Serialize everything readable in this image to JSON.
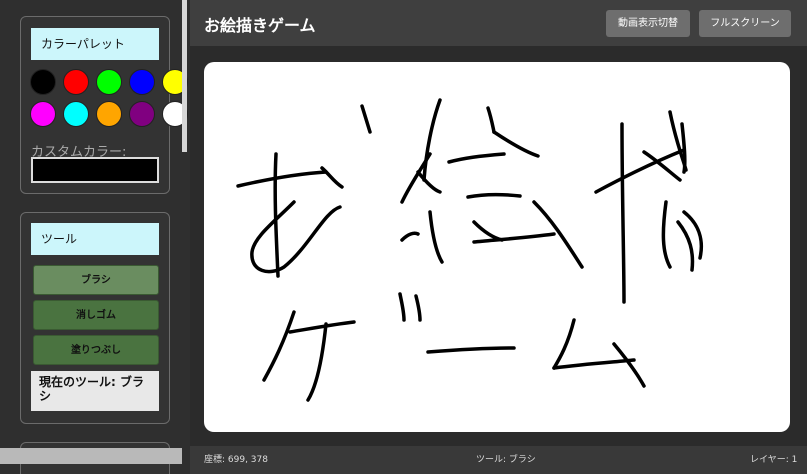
{
  "app": {
    "title": "お絵描きゲーム"
  },
  "header": {
    "video_toggle_label": "動画表示切替",
    "fullscreen_label": "フルスクリーン"
  },
  "color_palette": {
    "title": "カラーパレット",
    "swatches": [
      "#000000",
      "#ff0000",
      "#00ff00",
      "#0000ff",
      "#ffff00",
      "#ff00ff",
      "#00ffff",
      "#ffa500",
      "#800080",
      "#ffffff"
    ],
    "custom_label": "カスタムカラー:",
    "custom_value": "#000000"
  },
  "tools": {
    "title": "ツール",
    "brush_label": "ブラシ",
    "eraser_label": "消しゴム",
    "fill_label": "塗りつぶし",
    "current_tool_text": "現在のツール: ブラシ"
  },
  "statusbar": {
    "coordinates": "座標: 699, 378",
    "tool": "ツール: ブラシ",
    "layer": "レイヤー: 1"
  },
  "colors": {
    "accent_panel_title": "#ccf6fb",
    "tool_button": "#4a7340",
    "header_bg": "#3f3f3f"
  }
}
